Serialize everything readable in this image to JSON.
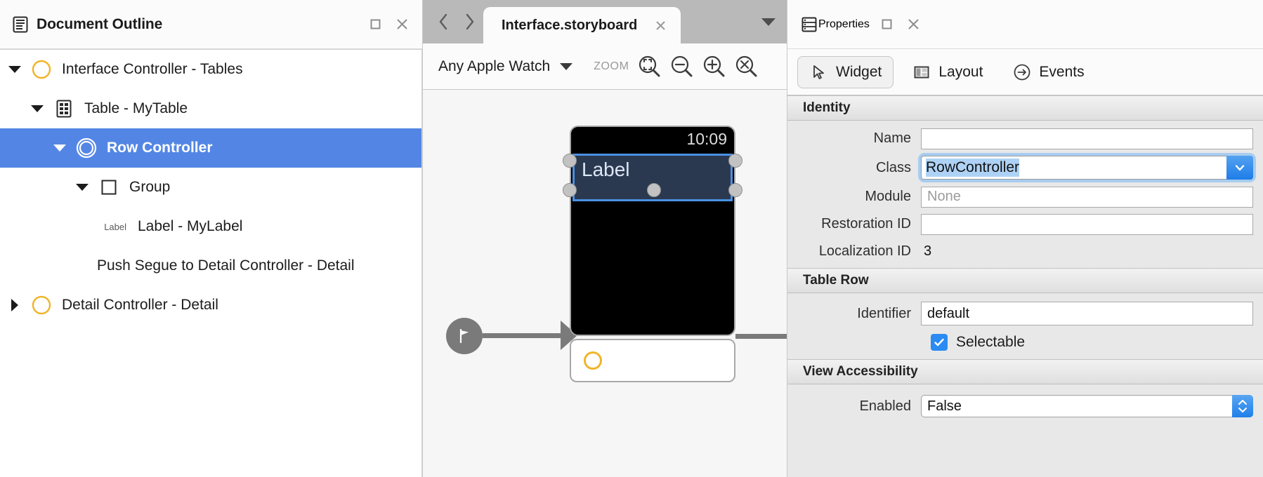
{
  "outline_panel": {
    "title": "Document Outline",
    "icon": "document-outline-icon",
    "maximize_label": "□",
    "close_label": "×",
    "tree": [
      {
        "label": "Interface Controller - Tables",
        "indent": 0,
        "twisty": "down",
        "icon": "controller-circle-icon",
        "selected": false
      },
      {
        "label": "Table - MyTable",
        "indent": 1,
        "twisty": "down",
        "icon": "table-icon",
        "selected": false
      },
      {
        "label": "Row Controller",
        "indent": 2,
        "twisty": "down",
        "icon": "row-controller-icon",
        "selected": true
      },
      {
        "label": "Group",
        "indent": 3,
        "twisty": "down",
        "icon": "group-square-icon",
        "selected": false
      },
      {
        "label": "Label - MyLabel",
        "indent": 4,
        "twisty": "none",
        "icon": "label-text-icon",
        "icon_text": "Label",
        "selected": false
      },
      {
        "label": "Push Segue to Detail Controller - Detail",
        "indent": 4,
        "twisty": "none",
        "icon": "none",
        "selected": false
      },
      {
        "label": "Detail Controller - Detail",
        "indent": 0,
        "twisty": "right",
        "icon": "controller-circle-icon",
        "selected": false
      }
    ]
  },
  "editor": {
    "back_label": "‹",
    "forward_label": "›",
    "tab_title": "Interface.storyboard",
    "tab_close_label": "✕",
    "tabstrip_menu_label": "▼",
    "toolbar": {
      "device": "Any Apple Watch",
      "zoom_label": "ZOOM",
      "buttons": [
        {
          "name": "zoom-fit-selection-icon"
        },
        {
          "name": "zoom-out-icon"
        },
        {
          "name": "zoom-in-icon"
        },
        {
          "name": "zoom-actual-size-icon"
        }
      ]
    },
    "canvas": {
      "entry_point_icon": "entry-point-flag-icon",
      "watch_time": "10:09",
      "watch_label_text": "Label",
      "detail_scene_icon": "controller-circle-icon"
    }
  },
  "properties_panel": {
    "title": "Properties",
    "icon": "properties-icon",
    "maximize_label": "□",
    "close_label": "×",
    "tabs": [
      {
        "label": "Widget",
        "icon": "cursor-arrow-icon",
        "active": true
      },
      {
        "label": "Layout",
        "icon": "layout-panes-icon",
        "active": false
      },
      {
        "label": "Events",
        "icon": "arrow-circle-right-icon",
        "active": false
      }
    ],
    "sections": [
      {
        "title": "Identity",
        "rows": [
          {
            "kind": "text",
            "label": "Name",
            "value": "",
            "placeholder": ""
          },
          {
            "kind": "combo",
            "label": "Class",
            "value": "RowController",
            "selected": true
          },
          {
            "kind": "text",
            "label": "Module",
            "value": "",
            "placeholder": "None"
          },
          {
            "kind": "text",
            "label": "Restoration ID",
            "value": "",
            "placeholder": ""
          },
          {
            "kind": "static",
            "label": "Localization ID",
            "value": "3"
          }
        ]
      },
      {
        "title": "Table Row",
        "rows": [
          {
            "kind": "text",
            "label": "Identifier",
            "value": "default",
            "placeholder": ""
          },
          {
            "kind": "checkbox",
            "label": "Selectable",
            "checked": true
          }
        ]
      },
      {
        "title": "View Accessibility",
        "rows": [
          {
            "kind": "stepper",
            "label": "Enabled",
            "value": "False"
          }
        ]
      }
    ]
  }
}
